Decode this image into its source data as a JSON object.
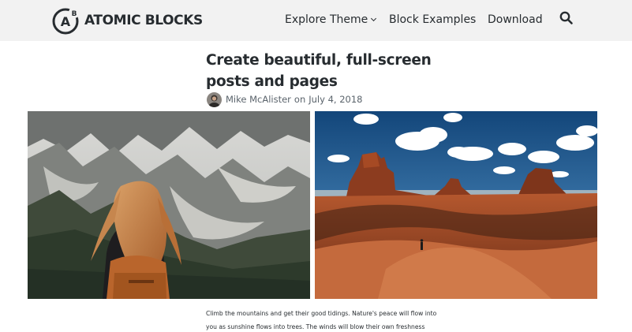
{
  "header": {
    "logo": {
      "text": "ATOMIC BLOCKS",
      "mark_letters": "AB",
      "icon": "atomic-blocks-logo-icon"
    },
    "nav": {
      "explore_theme": "Explore Theme",
      "block_examples": "Block Examples",
      "download": "Download"
    },
    "search_icon": "search-icon"
  },
  "post": {
    "title_line1": "Create beautiful, full-screen",
    "title_line2": "posts and pages",
    "author": "Mike McAlister",
    "date_prefix": "on",
    "date": "July 4, 2018",
    "body_lines": [
      "Climb the mountains and get their good tidings. Nature's peace will flow into",
      "you as sunshine flows into trees. The winds will blow their own freshness"
    ]
  },
  "colors": {
    "header_bg": "#f2f2f2",
    "text": "#272c30",
    "meta_text": "#5a636b"
  }
}
